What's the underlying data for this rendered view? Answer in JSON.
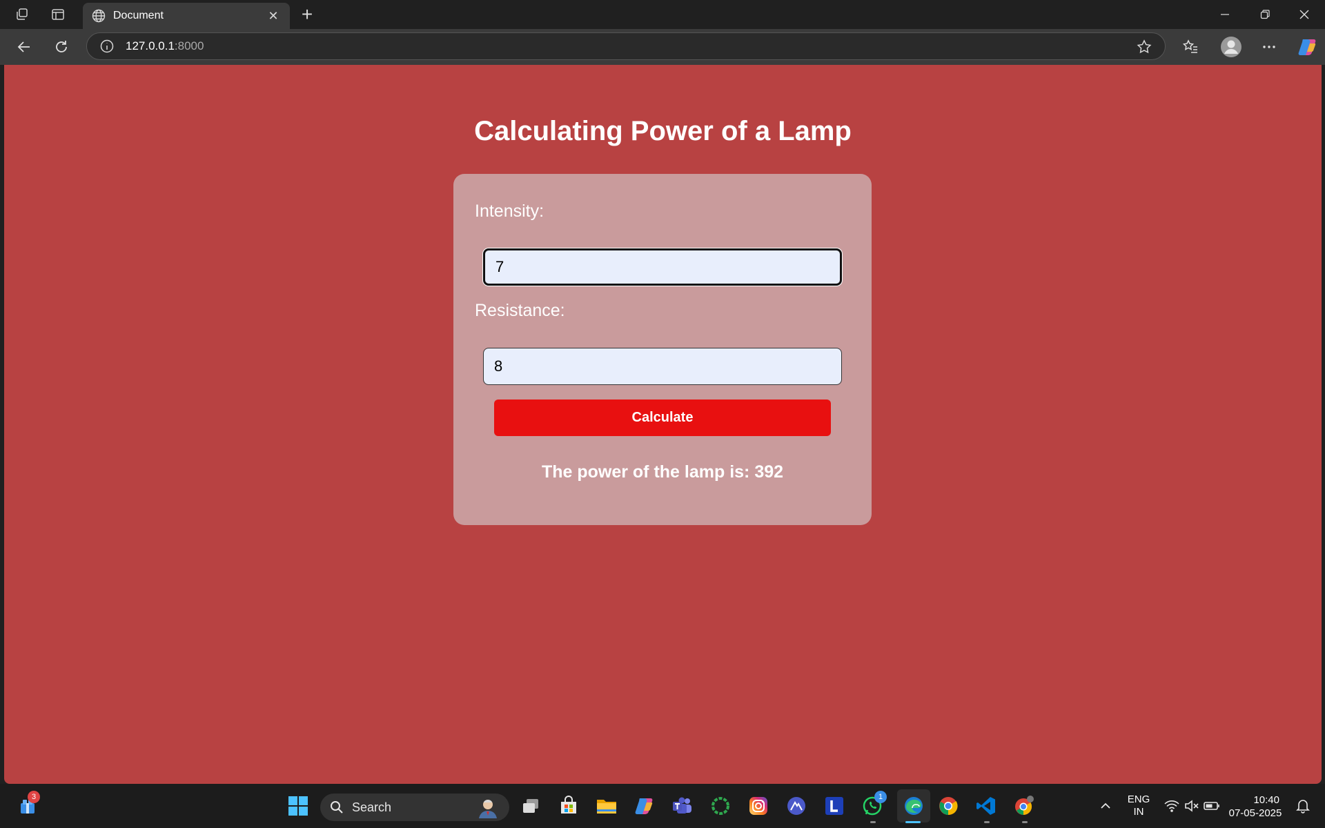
{
  "browser": {
    "tab_title": "Document",
    "new_tab_symbol": "+",
    "close_tab_symbol": "✕",
    "url_host": "127.0.0.1",
    "url_port": ":8000"
  },
  "page": {
    "title": "Calculating Power of a Lamp",
    "intensity_label": "Intensity:",
    "intensity_value": "7",
    "resistance_label": "Resistance:",
    "resistance_value": "8",
    "calculate_label": "Calculate",
    "result_text": "The power of the lamp is: 392",
    "colors": {
      "background": "#b84242",
      "card": "#c99b9c",
      "button": "#e81010",
      "input": "#e8eefc"
    }
  },
  "taskbar": {
    "widgets_badge": "3",
    "search_label": "Search",
    "whatsapp_badge": "1",
    "lang_primary": "ENG",
    "lang_secondary": "IN",
    "time": "10:40",
    "date": "07-05-2025",
    "icons": [
      "windows-start-icon",
      "task-view-icon",
      "microsoft-store-icon",
      "file-explorer-icon",
      "copilot-icon",
      "teams-icon",
      "ring-app-icon",
      "instagram-icon",
      "app-icon",
      "l-app-icon",
      "whatsapp-icon",
      "edge-icon",
      "chrome-icon",
      "vscode-icon",
      "chrome-profile-icon"
    ]
  }
}
